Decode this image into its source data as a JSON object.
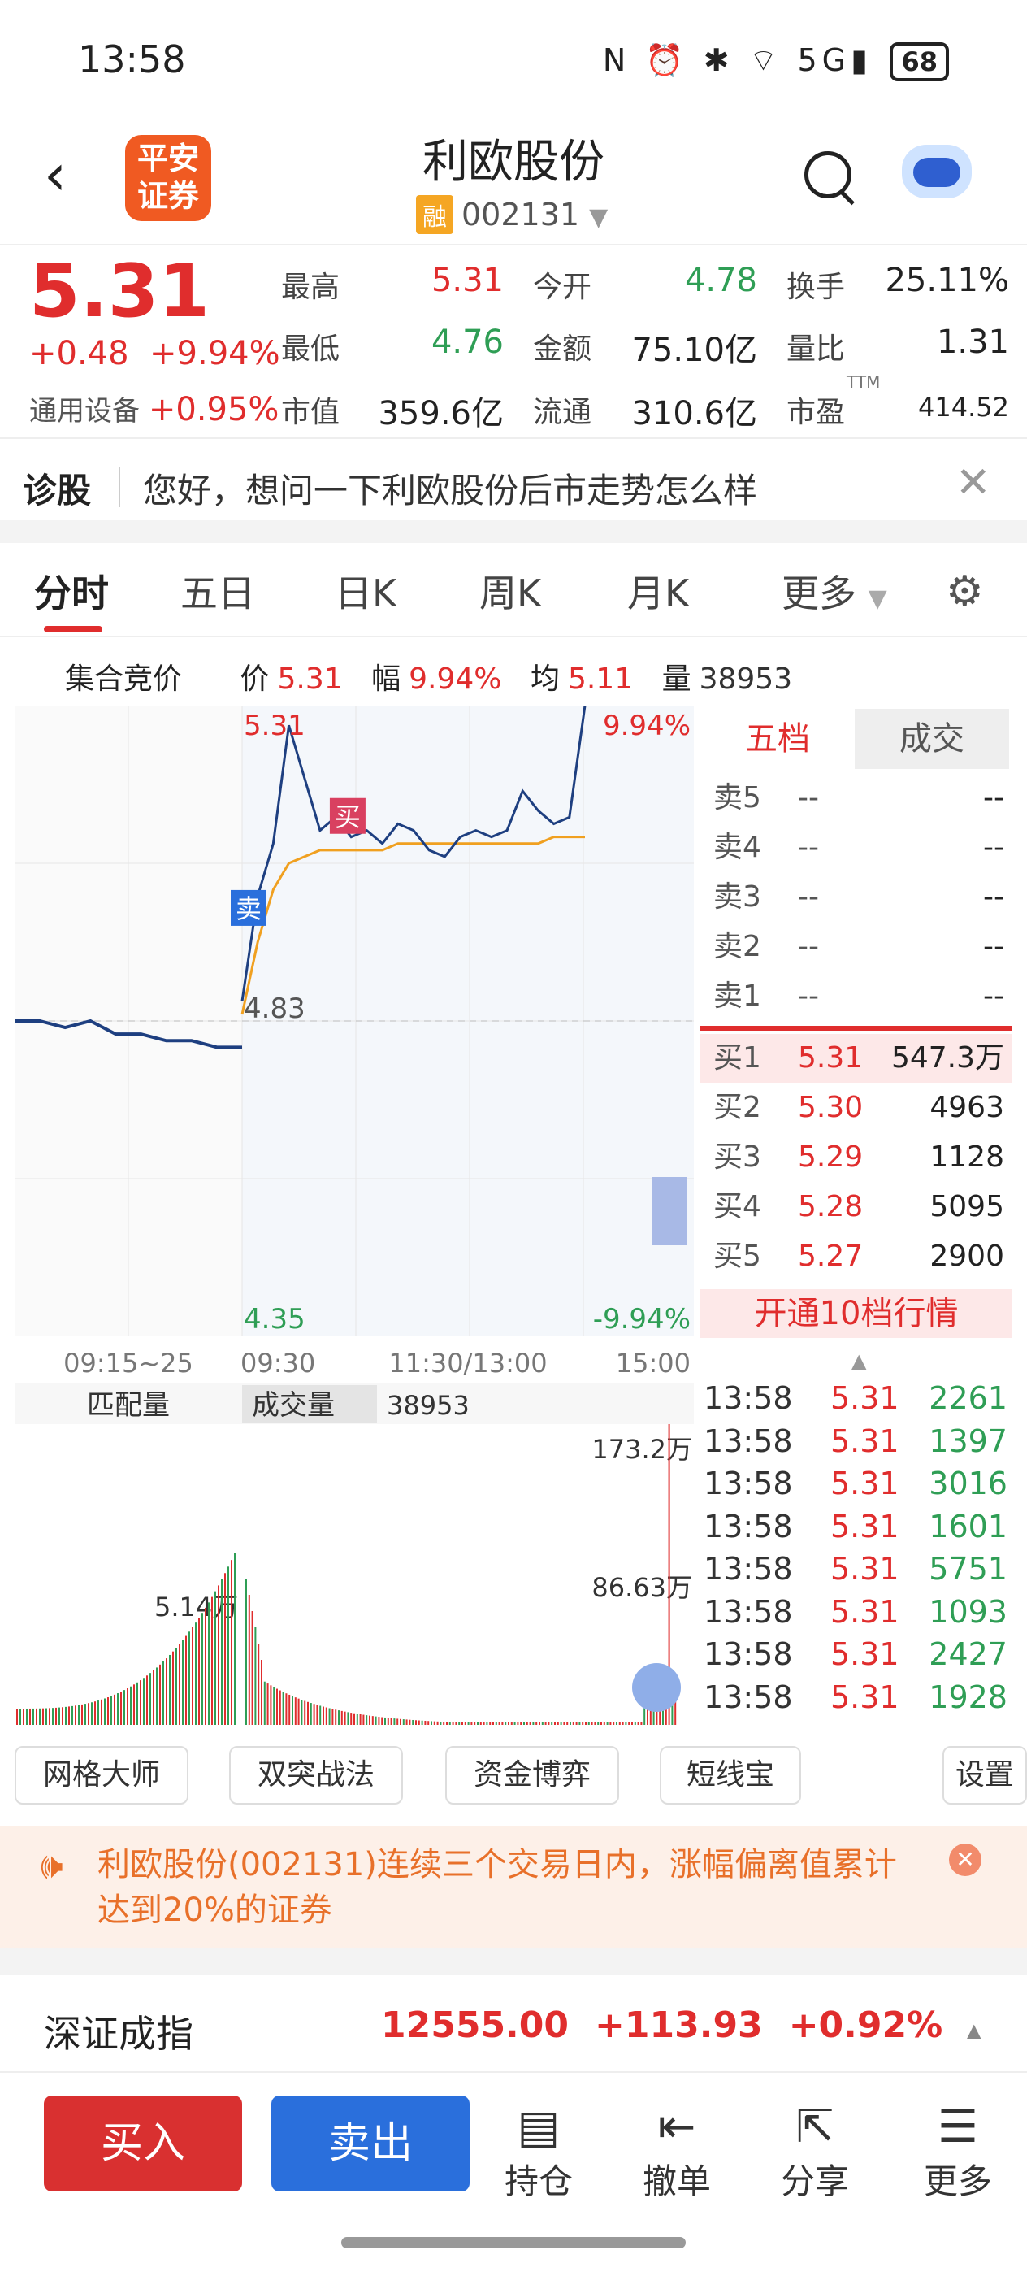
{
  "status_bar": {
    "time": "13:58",
    "icons": "N ⏰ ✱ ⌔ 5G▮",
    "battery": "68"
  },
  "header": {
    "logo": "平安\n证券",
    "title": "利欧股份",
    "badge": "融",
    "code": "002131"
  },
  "quote": {
    "price": "5.31",
    "change": "+0.48",
    "change_pct": "+9.94%",
    "sector_label": "通用设备",
    "sector_pct": "+0.95%",
    "fields": [
      {
        "label": "最高",
        "value": "5.31",
        "color": "#e02d2d"
      },
      {
        "label": "今开",
        "value": "4.78",
        "color": "#2f9e55"
      },
      {
        "label": "换手",
        "value": "25.11%",
        "color": "#222"
      },
      {
        "label": "最低",
        "value": "4.76",
        "color": "#2f9e55"
      },
      {
        "label": "金额",
        "value": "75.10亿",
        "color": "#222"
      },
      {
        "label": "量比",
        "value": "1.31",
        "color": "#222"
      },
      {
        "label": "市值",
        "value": "359.6亿",
        "color": "#222"
      },
      {
        "label": "流通",
        "value": "310.6亿",
        "color": "#222"
      },
      {
        "label": "市盈",
        "value": "414.52",
        "color": "#222"
      }
    ],
    "ttm": "TTM"
  },
  "diagnose": {
    "label": "诊股",
    "text": "您好，想问一下利欧股份后市走势怎么样"
  },
  "tabs": [
    "分时",
    "五日",
    "日K",
    "周K",
    "月K",
    "更多"
  ],
  "info_row": {
    "auction": "集合竞价",
    "price_label": "价",
    "price": "5.31",
    "amp_label": "幅",
    "amp": "9.94%",
    "avg_label": "均",
    "avg": "5.11",
    "vol_label": "量",
    "vol": "38953"
  },
  "chart_data": {
    "type": "line",
    "x_ticks": [
      "09:15~25",
      "09:30",
      "11:30/13:00",
      "15:00"
    ],
    "y_left_labels": [
      "5.31",
      "4.83",
      "4.35"
    ],
    "y_right_labels": [
      "9.94%",
      "-9.94%"
    ],
    "ylim": [
      4.35,
      5.31
    ],
    "auction_price": [
      4.83,
      4.83,
      4.82,
      4.83,
      4.81,
      4.81,
      4.8,
      4.8,
      4.79,
      4.79
    ],
    "price": [
      4.86,
      5.02,
      5.1,
      5.28,
      5.2,
      5.12,
      5.14,
      5.11,
      5.12,
      5.1,
      5.13,
      5.12,
      5.09,
      5.08,
      5.11,
      5.12,
      5.11,
      5.12,
      5.18,
      5.15,
      5.13,
      5.14,
      5.31
    ],
    "avg": [
      4.84,
      4.95,
      5.03,
      5.07,
      5.08,
      5.09,
      5.09,
      5.09,
      5.09,
      5.09,
      5.1,
      5.1,
      5.1,
      5.1,
      5.1,
      5.1,
      5.1,
      5.1,
      5.1,
      5.1,
      5.11,
      5.11,
      5.11
    ],
    "prev_close": 4.83,
    "markers": [
      {
        "label": "买",
        "price": 5.1
      },
      {
        "label": "卖",
        "price": 4.96
      }
    ],
    "volume_panel": {
      "label_left": "匹配量",
      "label_mid": "成交量",
      "value": "38953",
      "y_top": "173.2万",
      "y_mid": "86.63万",
      "auction_peak": "5.14万"
    }
  },
  "depth": {
    "tab_active": "五档",
    "tab_other": "成交",
    "asks": [
      {
        "name": "卖5",
        "price": "--",
        "vol": "--"
      },
      {
        "name": "卖4",
        "price": "--",
        "vol": "--"
      },
      {
        "name": "卖3",
        "price": "--",
        "vol": "--"
      },
      {
        "name": "卖2",
        "price": "--",
        "vol": "--"
      },
      {
        "name": "卖1",
        "price": "--",
        "vol": "--"
      }
    ],
    "bids": [
      {
        "name": "买1",
        "price": "5.31",
        "vol": "547.3万"
      },
      {
        "name": "买2",
        "price": "5.30",
        "vol": "4963"
      },
      {
        "name": "买3",
        "price": "5.29",
        "vol": "1128"
      },
      {
        "name": "买4",
        "price": "5.28",
        "vol": "5095"
      },
      {
        "name": "买5",
        "price": "5.27",
        "vol": "2900"
      }
    ],
    "open10": "开通10档行情"
  },
  "trades": [
    {
      "time": "13:58",
      "price": "5.31",
      "vol": "2261"
    },
    {
      "time": "13:58",
      "price": "5.31",
      "vol": "1397"
    },
    {
      "time": "13:58",
      "price": "5.31",
      "vol": "3016"
    },
    {
      "time": "13:58",
      "price": "5.31",
      "vol": "1601"
    },
    {
      "time": "13:58",
      "price": "5.31",
      "vol": "5751"
    },
    {
      "time": "13:58",
      "price": "5.31",
      "vol": "1093"
    },
    {
      "time": "13:58",
      "price": "5.31",
      "vol": "2427"
    },
    {
      "time": "13:58",
      "price": "5.31",
      "vol": "1928"
    }
  ],
  "tools": [
    "网格大师",
    "双突战法",
    "资金博弈",
    "短线宝",
    "设置"
  ],
  "notice": "利欧股份(002131)连续三个交易日内，涨幅偏离值累计达到20%的证券",
  "index": {
    "name": "深证成指",
    "value": "12555.00",
    "change": "+113.93",
    "pct": "+0.92%"
  },
  "bottom": {
    "buy": "买入",
    "sell": "卖出",
    "hold": "持仓",
    "cancel": "撤单",
    "share": "分享",
    "more": "更多"
  }
}
